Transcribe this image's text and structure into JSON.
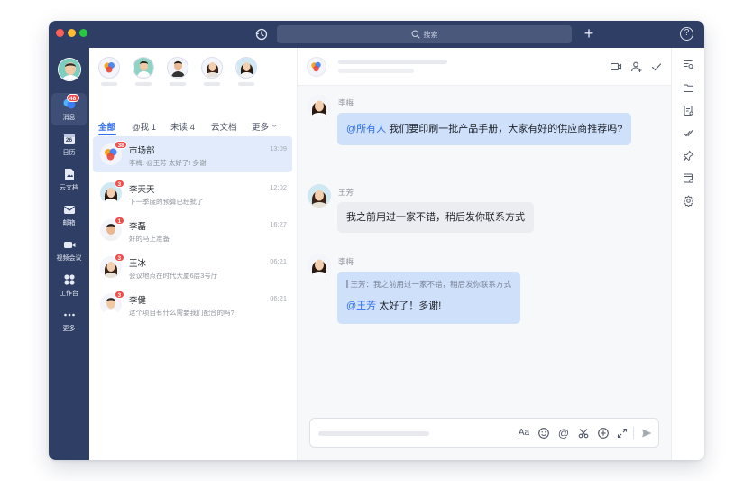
{
  "titlebar": {
    "search_placeholder": "搜索"
  },
  "nav": {
    "items": [
      {
        "label": "消息",
        "icon": "messages-icon",
        "badge": "48",
        "active": true
      },
      {
        "label": "日历",
        "icon": "calendar-icon",
        "calendar_day": "26"
      },
      {
        "label": "云文档",
        "icon": "cloud-docs-icon"
      },
      {
        "label": "邮箱",
        "icon": "mail-icon"
      },
      {
        "label": "视频会议",
        "icon": "video-meeting-icon"
      },
      {
        "label": "工作台",
        "icon": "workbench-icon"
      },
      {
        "label": "更多",
        "icon": "more-icon"
      }
    ]
  },
  "chatlist": {
    "tabs": [
      {
        "label": "全部",
        "active": true
      },
      {
        "label": "@我 1"
      },
      {
        "label": "未读 4"
      },
      {
        "label": "云文档"
      },
      {
        "label": "更多"
      }
    ],
    "conversations": [
      {
        "name": "市场部",
        "preview": "李梅: @王芳 太好了! 多谢",
        "time": "13:09",
        "badge": "38",
        "selected": true
      },
      {
        "name": "李天天",
        "preview": "下一季度的预算已经批了",
        "time": "12:02",
        "badge": "3"
      },
      {
        "name": "李磊",
        "preview": "好的马上准备",
        "time": "16:27",
        "badge": "1"
      },
      {
        "name": "王冰",
        "preview": "会议地点在时代大厦6层3号厅",
        "time": "06:21",
        "badge": "3"
      },
      {
        "name": "李健",
        "preview": "这个项目有什么需要我们配合的吗?",
        "time": "06:21",
        "badge": "3"
      }
    ]
  },
  "messages": [
    {
      "sender": "李梅",
      "mention": "@所有人",
      "text": " 我们要印刷一批产品手册，大家有好的供应商推荐吗?",
      "style": "blue"
    },
    {
      "sender": "王芳",
      "text": "我之前用过一家不错，稍后发你联系方式",
      "style": "gray"
    },
    {
      "sender": "李梅",
      "quote": "王芳：我之前用过一家不错，稍后发你联系方式",
      "mention": "@王芳",
      "text": " 太好了！多谢!",
      "style": "blue"
    }
  ],
  "colors": {
    "accent": "#2f6ff0",
    "nav_bg": "#2f3e64",
    "badge": "#f54a45",
    "bubble_blue": "#cfe0fb"
  }
}
